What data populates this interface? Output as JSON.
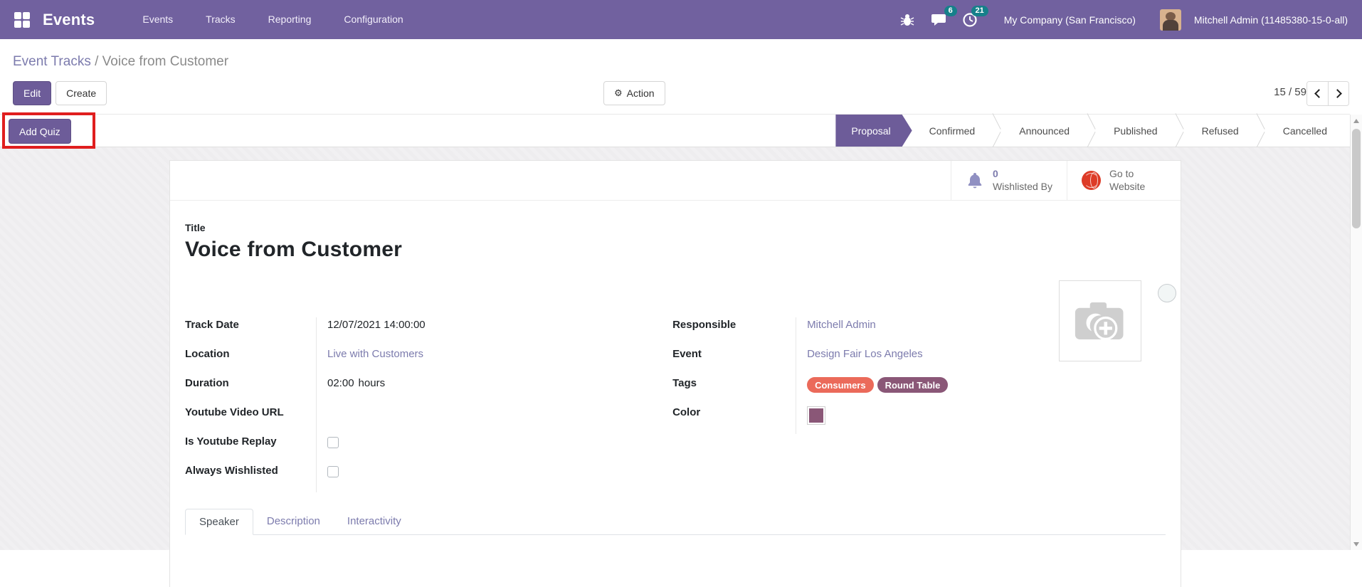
{
  "navbar": {
    "brand": "Events",
    "menu": [
      {
        "label": "Events"
      },
      {
        "label": "Tracks"
      },
      {
        "label": "Reporting"
      },
      {
        "label": "Configuration"
      }
    ],
    "systray": {
      "messages_count": "6",
      "activities_count": "21",
      "company": "My Company (San Francisco)",
      "user": "Mitchell Admin (11485380-15-0-all)"
    }
  },
  "breadcrumb": {
    "parent": "Event Tracks",
    "separator": "/",
    "current": "Voice from Customer"
  },
  "control_panel": {
    "edit_label": "Edit",
    "create_label": "Create",
    "action_label": "Action",
    "pager": {
      "value": "15 / 59"
    }
  },
  "header": {
    "add_quiz_label": "Add Quiz",
    "statuses": [
      {
        "label": "Proposal",
        "active": true
      },
      {
        "label": "Confirmed",
        "active": false
      },
      {
        "label": "Announced",
        "active": false
      },
      {
        "label": "Published",
        "active": false
      },
      {
        "label": "Refused",
        "active": false
      },
      {
        "label": "Cancelled",
        "active": false
      }
    ]
  },
  "sheet": {
    "stat_buttons": {
      "wishlist": {
        "count": "0",
        "label": "Wishlisted By"
      },
      "website": {
        "line1": "Go to",
        "line2": "Website"
      }
    },
    "title_label": "Title",
    "title": "Voice from Customer",
    "fields_left": [
      {
        "label": "Track Date",
        "value": "12/07/2021 14:00:00"
      },
      {
        "label": "Location",
        "value": "Live with Customers"
      },
      {
        "label": "Duration",
        "value": "02:00",
        "suffix": "hours"
      },
      {
        "label": "Youtube Video URL",
        "value": ""
      },
      {
        "label": "Is Youtube Replay",
        "checked": false
      },
      {
        "label": "Always Wishlisted",
        "checked": false
      }
    ],
    "fields_right": [
      {
        "label": "Responsible",
        "value": "Mitchell Admin"
      },
      {
        "label": "Event",
        "value": "Design Fair Los Angeles"
      },
      {
        "label": "Tags",
        "tags": [
          "Consumers",
          "Round Table"
        ]
      },
      {
        "label": "Color"
      }
    ],
    "tabs": [
      {
        "label": "Speaker",
        "active": true
      },
      {
        "label": "Description",
        "active": false
      },
      {
        "label": "Interactivity",
        "active": false
      }
    ]
  },
  "colors": {
    "navbar_bg": "#71619F",
    "accent": "#6D5C99",
    "accent_border": "#5E5085",
    "link": "#7C7BAD",
    "badge": "#16808A",
    "tag_consumers": "#EB6A5A",
    "tag_round_table": "#8A5777",
    "color_swatch": "#8A5777",
    "globe": "#DD3B27",
    "annotation": "#E01E1E"
  }
}
